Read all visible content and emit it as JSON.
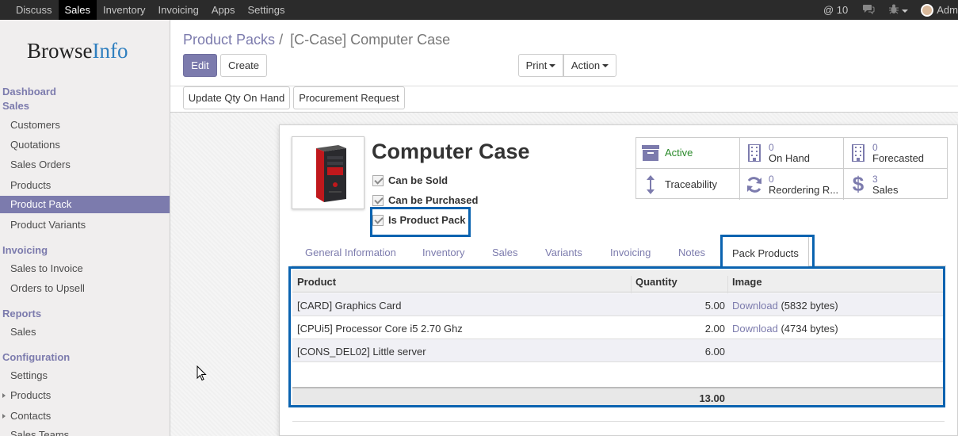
{
  "topnav": {
    "items": [
      "Discuss",
      "Sales",
      "Inventory",
      "Invoicing",
      "Apps",
      "Settings"
    ],
    "active": "Sales",
    "notifications": "10",
    "user": "Adm"
  },
  "sidebar": {
    "logo_part1": "Browse",
    "logo_part2": "Info",
    "sections": {
      "dashboard": "Dashboard",
      "sales": "Sales",
      "invoicing": "Invoicing",
      "reports": "Reports",
      "configuration": "Configuration"
    },
    "items": {
      "customers": "Customers",
      "quotations": "Quotations",
      "sales_orders": "Sales Orders",
      "products": "Products",
      "product_pack": "Product Pack",
      "product_variants": "Product Variants",
      "sales_to_invoice": "Sales to Invoice",
      "orders_to_upsell": "Orders to Upsell",
      "reports_sales": "Sales",
      "settings": "Settings",
      "config_products": "Products",
      "contacts": "Contacts",
      "sales_teams": "Sales Teams"
    }
  },
  "header": {
    "breadcrumb_parent": "Product Packs",
    "breadcrumb_sep": "/",
    "breadcrumb_current": "[C-Case] Computer Case",
    "edit": "Edit",
    "create": "Create",
    "print": "Print",
    "action": "Action"
  },
  "statusbar": {
    "update_qty": "Update Qty On Hand",
    "procurement": "Procurement Request"
  },
  "product": {
    "name": "Computer Case",
    "can_be_sold": "Can be Sold",
    "can_be_purchased": "Can be Purchased",
    "is_product_pack": "Is Product Pack"
  },
  "stats": {
    "active": "Active",
    "on_hand_num": "0",
    "on_hand": "On Hand",
    "forecasted_num": "0",
    "forecasted": "Forecasted",
    "traceability": "Traceability",
    "reordering_num": "0",
    "reordering": "Reordering R...",
    "sales_num": "3",
    "sales": "Sales"
  },
  "tabs": [
    "General Information",
    "Inventory",
    "Sales",
    "Variants",
    "Invoicing",
    "Notes",
    "Pack Products"
  ],
  "table": {
    "headers": {
      "product": "Product",
      "quantity": "Quantity",
      "image": "Image"
    },
    "rows": [
      {
        "product": "[CARD] Graphics Card",
        "quantity": "5.00",
        "link": "Download",
        "size": "(5832 bytes)"
      },
      {
        "product": "[CPUi5] Processor Core i5 2.70 Ghz",
        "quantity": "2.00",
        "link": "Download",
        "size": "(4734 bytes)"
      },
      {
        "product": "[CONS_DEL02] Little server",
        "quantity": "6.00",
        "link": "",
        "size": ""
      }
    ],
    "total": "13.00"
  }
}
